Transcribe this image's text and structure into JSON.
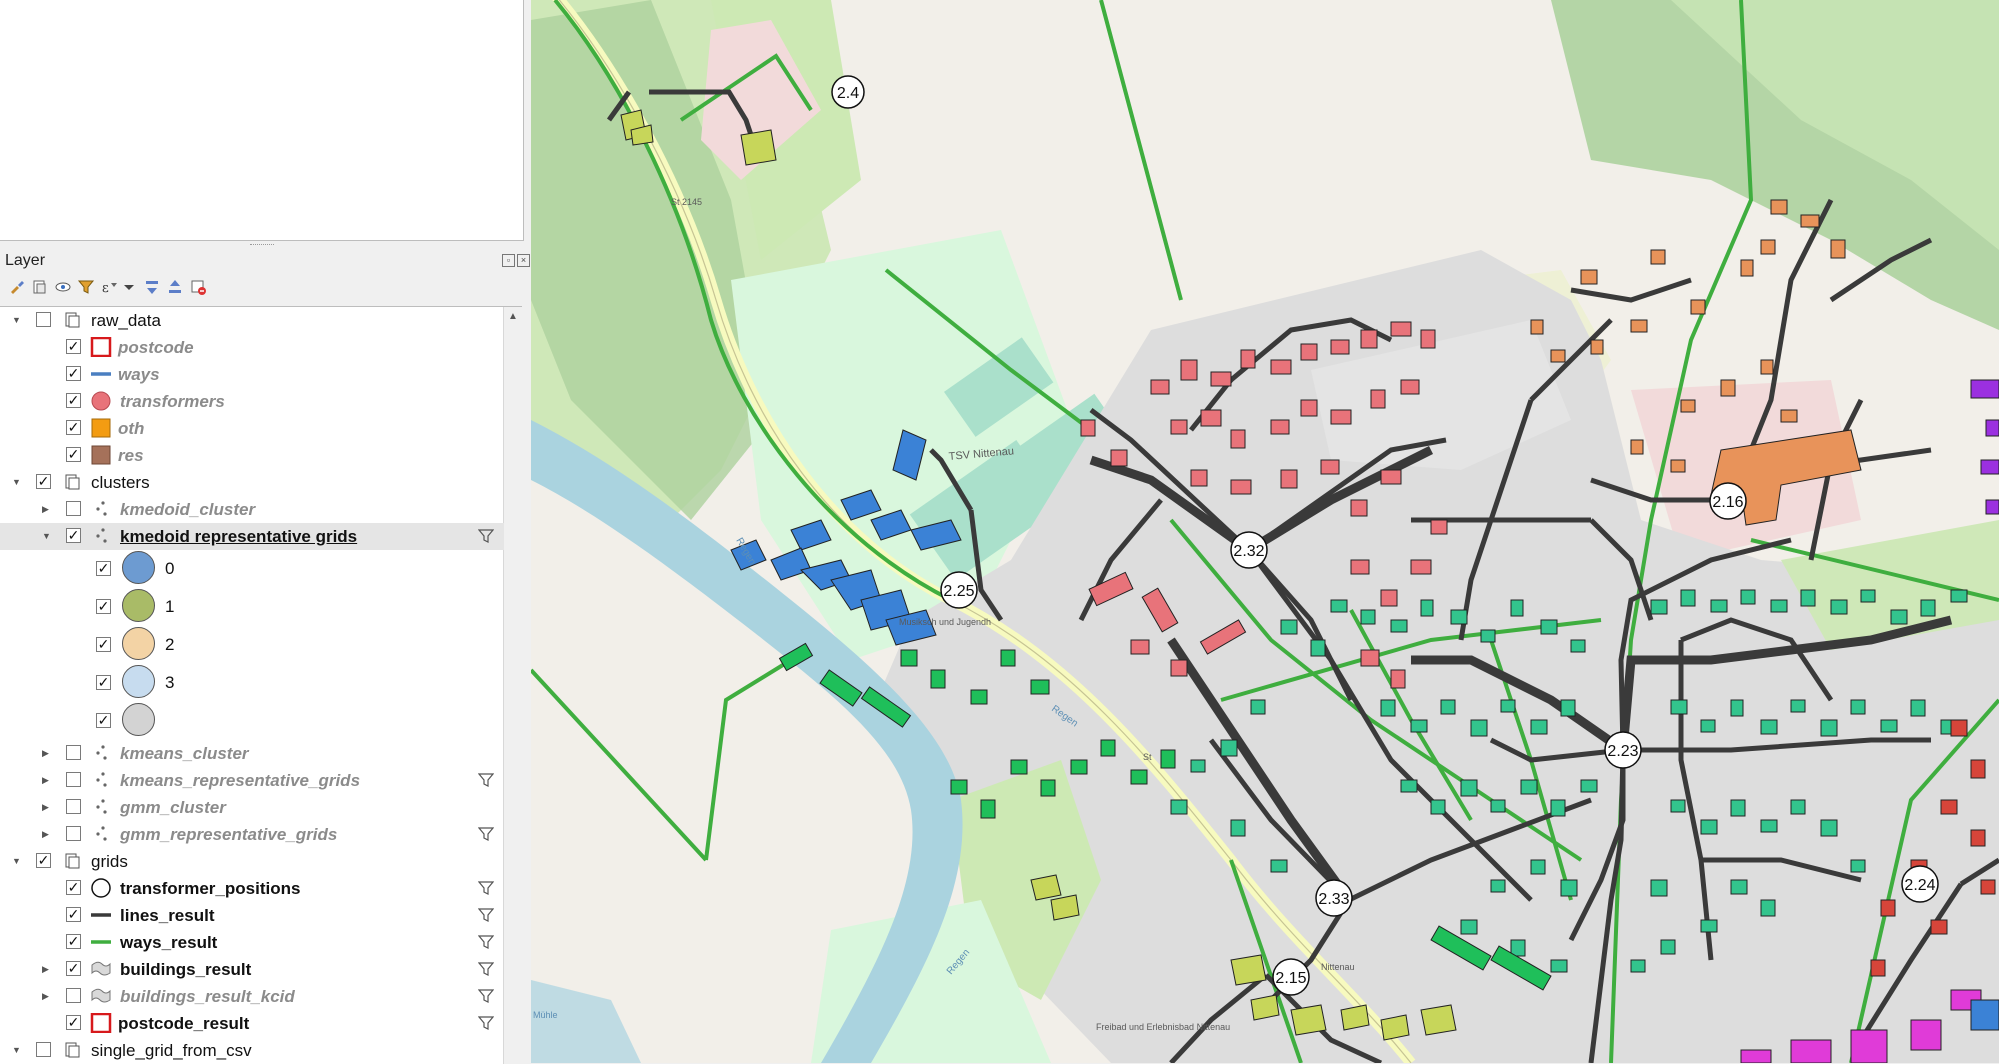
{
  "panel": {
    "title": "Layer"
  },
  "toolbar": {
    "icons": [
      "style-brush-icon",
      "add-group-icon",
      "visibility-eye-icon",
      "filter-legend-icon",
      "expression-filter-icon",
      "expand-all-icon",
      "collapse-all-icon",
      "remove-layer-icon"
    ]
  },
  "tree": {
    "raw_data": "raw_data",
    "postcode": "postcode",
    "ways": "ways",
    "transformers": "transformers",
    "oth": "oth",
    "res": "res",
    "clusters": "clusters",
    "kmedoid_cluster": "kmedoid_cluster",
    "kmedoid_rep": "kmedoid representative grids",
    "class_0": "0",
    "class_1": "1",
    "class_2": "2",
    "class_3": "3",
    "kmeans_cluster": "kmeans_cluster",
    "kmeans_rep": "kmeans_representative_grids",
    "gmm_cluster": "gmm_cluster",
    "gmm_rep": "gmm_representative_grids",
    "grids": "grids",
    "transformer_positions": "transformer_positions",
    "lines_result": "lines_result",
    "ways_result": "ways_result",
    "buildings_result": "buildings_result",
    "buildings_result_kcid": "buildings_result_kcid",
    "postcode_result": "postcode_result",
    "single_grid": "single_grid_from_csv"
  },
  "colors": {
    "postcode": "#d7191c",
    "ways": "#4a7fc1",
    "transformers": "#e8737a",
    "oth": "#f39c12",
    "res": "#a5715a",
    "class_0": "#6d9bd1",
    "class_1": "#a9bb67",
    "class_2": "#f3d3a5",
    "class_3": "#c7dcef",
    "class_other": "#d3d3d3",
    "lines_result": "#3a3a3a",
    "ways_result": "#3fae3f"
  },
  "map": {
    "transformer_labels": [
      "2.4",
      "2.32",
      "2.25",
      "2.16",
      "2.23",
      "2.33",
      "2.15",
      "2.24"
    ],
    "place_labels": [
      "TSV Nittenau",
      "Musiksch und Jugendh",
      "Regen",
      "Regen",
      "Regen",
      "Freibad und Erlebnisbad Nittenau",
      "St 2145",
      "St",
      "Nittenau",
      "Mühle"
    ]
  }
}
